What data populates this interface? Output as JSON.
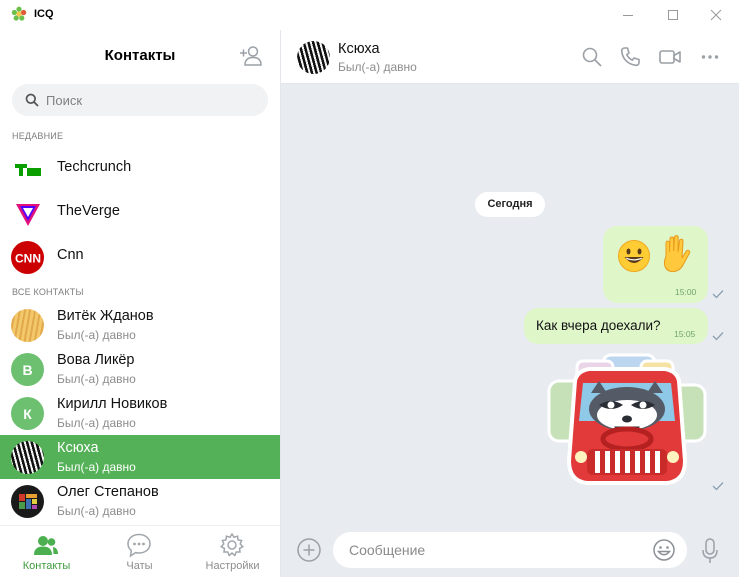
{
  "window": {
    "title": "ICQ",
    "logo_icon": "icq-flower-icon",
    "controls": [
      "minimize-icon",
      "maximize-icon",
      "close-icon"
    ]
  },
  "sidebar": {
    "title": "Контакты",
    "add_contact_icon": "add-contact-icon",
    "search": {
      "placeholder": "Поиск",
      "value": ""
    },
    "recent_label": "НЕДАВНИЕ",
    "recent": [
      {
        "name": "Techcrunch",
        "avatar": "techcrunch-logo"
      },
      {
        "name": "TheVerge",
        "avatar": "theverge-logo"
      },
      {
        "name": "Cnn",
        "avatar": "cnn-logo"
      }
    ],
    "all_label": "ВСЕ КОНТАКТЫ",
    "contacts": [
      {
        "name": "Витёк Жданов",
        "status": "Был(-а) давно",
        "avatar": "photo",
        "initial": ""
      },
      {
        "name": "Вова Ликёр",
        "status": "Был(-а) давно",
        "avatar": "initial",
        "initial": "В"
      },
      {
        "name": "Кирилл Новиков",
        "status": "Был(-а) давно",
        "avatar": "initial",
        "initial": "К"
      },
      {
        "name": "Ксюха",
        "status": "Был(-а) давно",
        "avatar": "photo",
        "initial": "",
        "active": true
      },
      {
        "name": "Олег Степанов",
        "status": "Был(-а) давно",
        "avatar": "photo",
        "initial": ""
      }
    ],
    "tabs": [
      {
        "label": "Контакты",
        "icon": "contacts-icon",
        "active": true
      },
      {
        "label": "Чаты",
        "icon": "chat-bubble-icon",
        "active": false
      },
      {
        "label": "Настройки",
        "icon": "gear-icon",
        "active": false
      }
    ]
  },
  "chat": {
    "contact_name": "Ксюха",
    "contact_status": "Был(-а) давно",
    "header_icons": [
      "search-icon",
      "phone-icon",
      "video-icon",
      "more-icon"
    ],
    "date_separator": "Сегодня",
    "messages": [
      {
        "type": "emoji",
        "content": [
          "grinning-face-emoji",
          "waving-hand-emoji"
        ],
        "time": "15:00",
        "outgoing": true
      },
      {
        "type": "text",
        "text": "Как вчера доехали?",
        "time": "15:05",
        "outgoing": true
      },
      {
        "type": "sticker",
        "content": "raccoon-driving-car-sticker",
        "outgoing": true
      }
    ],
    "composer": {
      "placeholder": "Сообщение",
      "value": ""
    }
  },
  "colors": {
    "accent_green": "#54b157",
    "outgoing_bubble": "#dff6c9",
    "chat_background": "#e8ecf1"
  }
}
